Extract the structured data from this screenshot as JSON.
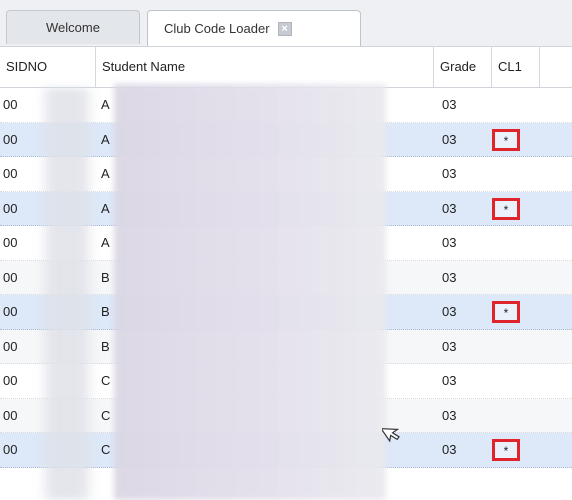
{
  "tabs": {
    "welcome": "Welcome",
    "club_code_loader": "Club Code Loader",
    "close_symbol": "×"
  },
  "table": {
    "headers": {
      "sidno": "SIDNO",
      "student_name": "Student Name",
      "grade": "Grade",
      "cl1": "CL1"
    },
    "rows": [
      {
        "sidno": "00",
        "name": "A",
        "grade": "03",
        "cl1": ""
      },
      {
        "sidno": "00",
        "name": "A",
        "grade": "03",
        "cl1": "*"
      },
      {
        "sidno": "00",
        "name": "A",
        "grade": "03",
        "cl1": ""
      },
      {
        "sidno": "00",
        "name": "A",
        "grade": "03",
        "cl1": "*"
      },
      {
        "sidno": "00",
        "name": "A",
        "grade": "03",
        "cl1": ""
      },
      {
        "sidno": "00",
        "name": "B",
        "grade": "03",
        "cl1": ""
      },
      {
        "sidno": "00",
        "name": "B",
        "grade": "03",
        "cl1": "*"
      },
      {
        "sidno": "00",
        "name": "B",
        "grade": "03",
        "cl1": ""
      },
      {
        "sidno": "00",
        "name": "C",
        "grade": "03",
        "cl1": ""
      },
      {
        "sidno": "00",
        "name": "C",
        "grade": "03",
        "cl1": ""
      },
      {
        "sidno": "00",
        "name": "C",
        "grade": "03",
        "cl1": "*"
      }
    ]
  },
  "colors": {
    "highlight_box": "#e0242c",
    "selected_row": "#dde8f8"
  }
}
